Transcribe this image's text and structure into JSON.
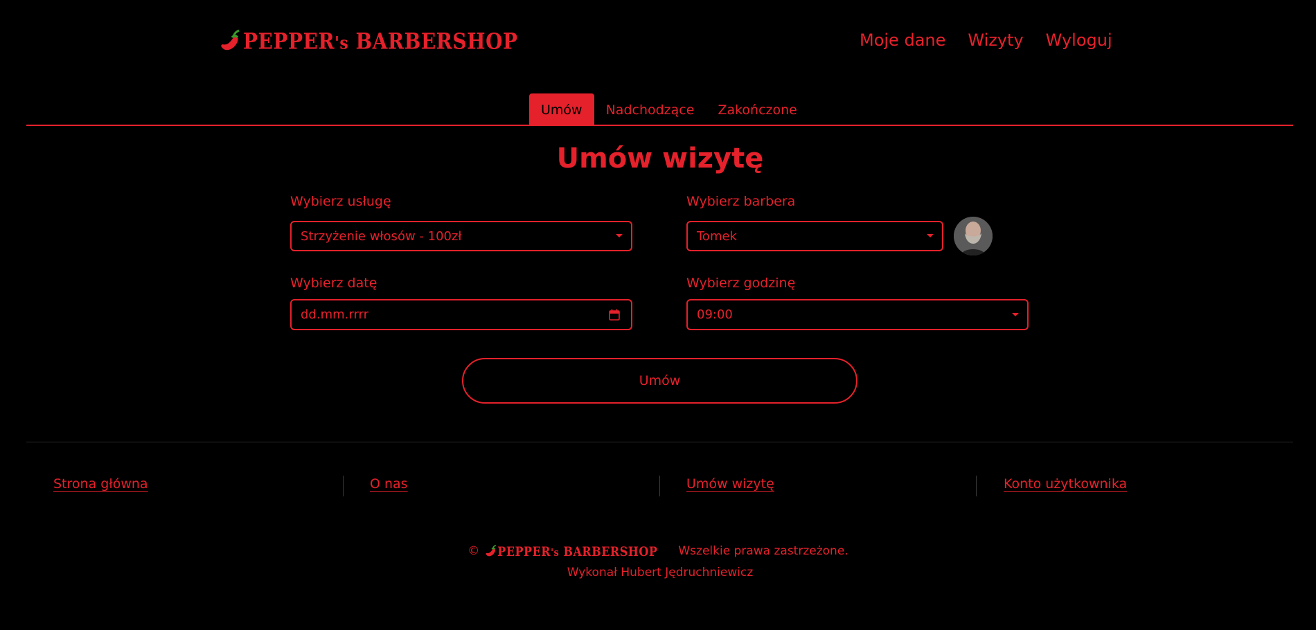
{
  "brand": {
    "name": "PEPPER's BARBERSHOP",
    "name_a": "PEPPER",
    "name_b": "'s",
    "name_c": " BARBERSHOP"
  },
  "nav": {
    "items": [
      "Moje dane",
      "Wizyty",
      "Wyloguj"
    ]
  },
  "tabs": {
    "items": [
      "Umów",
      "Nadchodzące",
      "Zakończone"
    ],
    "active": "Umów"
  },
  "form": {
    "title": "Umów wizytę",
    "service_label": "Wybierz usługę",
    "service_value": "Strzyżenie włosów - 100zł",
    "barber_label": "Wybierz barbera",
    "barber_value": "Tomek",
    "date_label": "Wybierz datę",
    "date_placeholder": "dd.mm.rrrr",
    "time_label": "Wybierz godzinę",
    "time_value": "09:00",
    "submit_label": "Umów"
  },
  "footer": {
    "links": [
      "Strona główna",
      "O nas",
      "Umów wizytę",
      "Konto użytkownika"
    ],
    "copyright_symbol": "©",
    "rights": "Wszelkie prawa zastrzeżone.",
    "author": "Wykonał Hubert Jędruchniewicz"
  },
  "colors": {
    "accent": "#e5212b",
    "background": "#000000"
  },
  "icons": {
    "logo": "chili-pepper-icon",
    "date": "calendar-icon",
    "select": "caret-down-icon"
  }
}
